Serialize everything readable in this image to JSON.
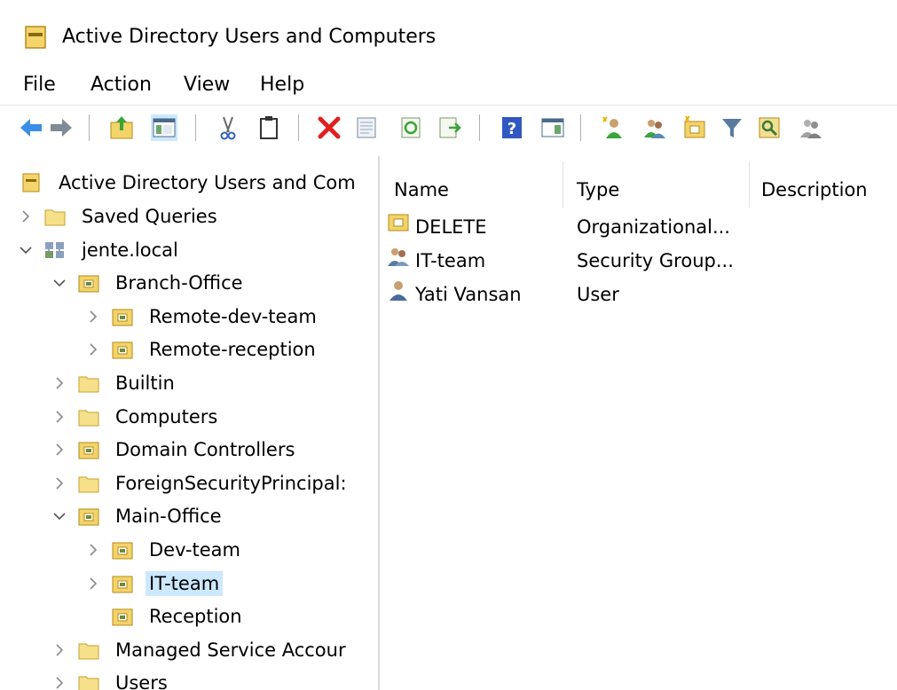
{
  "window": {
    "title": "Active Directory Users and Computers",
    "icon": "folder-icon"
  },
  "menu": {
    "items": [
      "File",
      "Action",
      "View",
      "Help"
    ]
  },
  "toolbar": {
    "buttons": [
      "back-arrow-icon",
      "forward-arrow-icon",
      "up-one-level-icon",
      "show-hide-console-tree-icon",
      "cut-icon",
      "copy-icon",
      "delete-icon",
      "properties-icon",
      "refresh-icon",
      "export-list-icon",
      "help-icon",
      "action-pane-icon",
      "new-user-icon",
      "new-group-icon",
      "new-ou-icon",
      "filter-icon",
      "find-icon",
      "add-to-group-icon"
    ]
  },
  "tree": {
    "root": "Active Directory Users and Com",
    "items": [
      {
        "label": "Saved Queries",
        "chevron": "right",
        "icon": "folder"
      },
      {
        "label": "jente.local",
        "chevron": "down",
        "icon": "domain"
      },
      {
        "label": "Branch-Office",
        "chevron": "down",
        "icon": "ou"
      },
      {
        "label": "Remote-dev-team",
        "chevron": "right",
        "icon": "ou"
      },
      {
        "label": "Remote-reception",
        "chevron": "right",
        "icon": "ou"
      },
      {
        "label": "Builtin",
        "chevron": "right",
        "icon": "folder"
      },
      {
        "label": "Computers",
        "chevron": "right",
        "icon": "folder"
      },
      {
        "label": "Domain Controllers",
        "chevron": "right",
        "icon": "ou"
      },
      {
        "label": "ForeignSecurityPrincipal:",
        "chevron": "right",
        "icon": "folder"
      },
      {
        "label": "Main-Office",
        "chevron": "down",
        "icon": "ou"
      },
      {
        "label": "Dev-team",
        "chevron": "right",
        "icon": "ou"
      },
      {
        "label": "IT-team",
        "chevron": "right",
        "icon": "ou",
        "selected": true
      },
      {
        "label": "Reception",
        "chevron": "none",
        "icon": "ou"
      },
      {
        "label": "Managed Service Accour",
        "chevron": "right",
        "icon": "folder"
      },
      {
        "label": "Users",
        "chevron": "right",
        "icon": "folder"
      }
    ]
  },
  "list": {
    "columns": [
      "Name",
      "Type",
      "Description"
    ],
    "rows": [
      {
        "name": "DELETE",
        "type": "Organizational...",
        "description": "",
        "icon": "ou"
      },
      {
        "name": "IT-team",
        "type": "Security Group...",
        "description": "",
        "icon": "group"
      },
      {
        "name": "Yati Vansan",
        "type": "User",
        "description": "",
        "icon": "user"
      }
    ]
  },
  "colors": {
    "selection": "#cce8ff",
    "folder": "#f2d46a",
    "delete_red": "#e02020",
    "arrow_blue": "#3a8ee6"
  }
}
